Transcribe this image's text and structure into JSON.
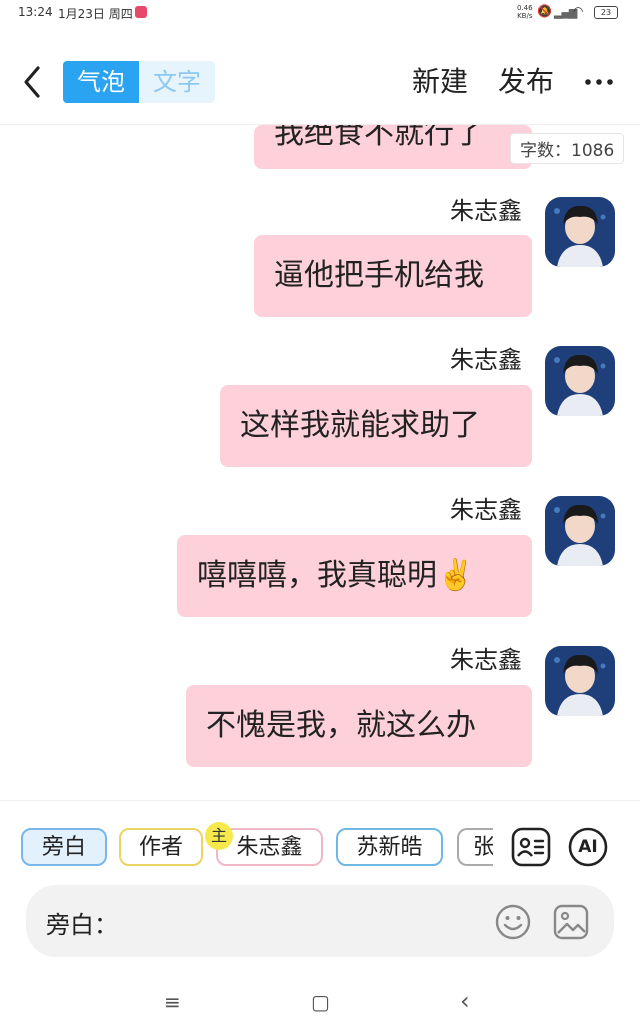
{
  "status_bar": {
    "time": "13:24",
    "date": "1月23日 周四",
    "net_speed_top": "0.46",
    "net_speed_bottom": "KB/s",
    "battery": "23"
  },
  "header": {
    "back_icon": "chevron-left-icon",
    "toggle_bubble": "气泡",
    "toggle_text": "文字",
    "new_label": "新建",
    "publish_label": "发布",
    "more_icon": "more-horizontal-icon"
  },
  "chat": {
    "word_count_label": "字数：1086",
    "partial_message": "我绝食不就行了",
    "messages": [
      {
        "sender": "朱志鑫",
        "text": "逼他把手机给我"
      },
      {
        "sender": "朱志鑫",
        "text": "这样我就能求助了"
      },
      {
        "sender": "朱志鑫",
        "text": "嘻嘻嘻，我真聪明✌️"
      },
      {
        "sender": "朱志鑫",
        "text": "不愧是我，就这么办"
      }
    ]
  },
  "roles": {
    "chips": [
      "旁白",
      "作者",
      "朱志鑫",
      "苏新皓",
      "张"
    ],
    "main_badge": "主",
    "contacts_icon": "contact-card-icon",
    "ai_label": "AI"
  },
  "input": {
    "label": "旁白：",
    "placeholder": "",
    "emoji_icon": "emoji-icon",
    "image_icon": "image-icon"
  },
  "nav": {
    "menu_icon": "≡",
    "home_icon": "▢",
    "back_icon": "‹"
  },
  "colors": {
    "accent": "#2aa3f1",
    "bubble": "#fdd0da",
    "panel_bg": "#f2f2f2"
  }
}
